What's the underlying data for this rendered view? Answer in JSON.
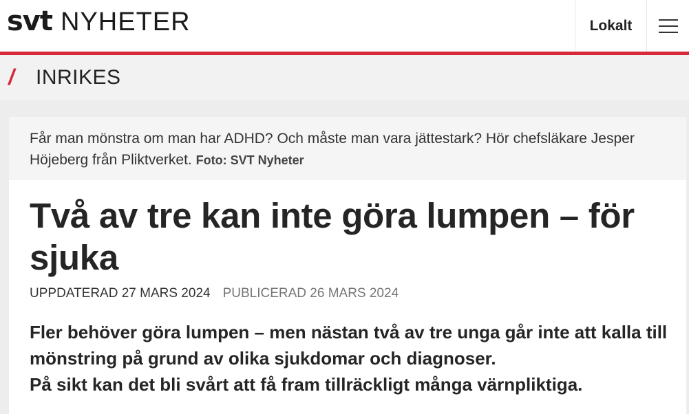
{
  "header": {
    "logo_svt": "svt",
    "logo_section": "NYHETER",
    "lokalt_label": "Lokalt",
    "menu_icon": "hamburger-menu-icon",
    "accent_color": "#d6293b"
  },
  "section": {
    "slash": "/",
    "label": "INRIKES"
  },
  "article": {
    "caption": "Får man mönstra om man har ADHD? Och måste man vara jättestark? Hör chefsläkare Jesper Höjeberg från Pliktverket.",
    "photo_credit": "Foto: SVT Nyheter",
    "headline": "Två av tre kan inte göra lumpen – för sjuka",
    "updated": "UPPDATERAD 27 MARS 2024",
    "published": "PUBLICERAD 26 MARS 2024",
    "lead_1": "Fler behöver göra lumpen – men nästan två av tre unga går inte att kalla till mönstring på grund av olika sjukdomar och diagnoser.",
    "lead_2": "På sikt kan det bli svårt att få fram tillräckligt många värnpliktiga."
  }
}
